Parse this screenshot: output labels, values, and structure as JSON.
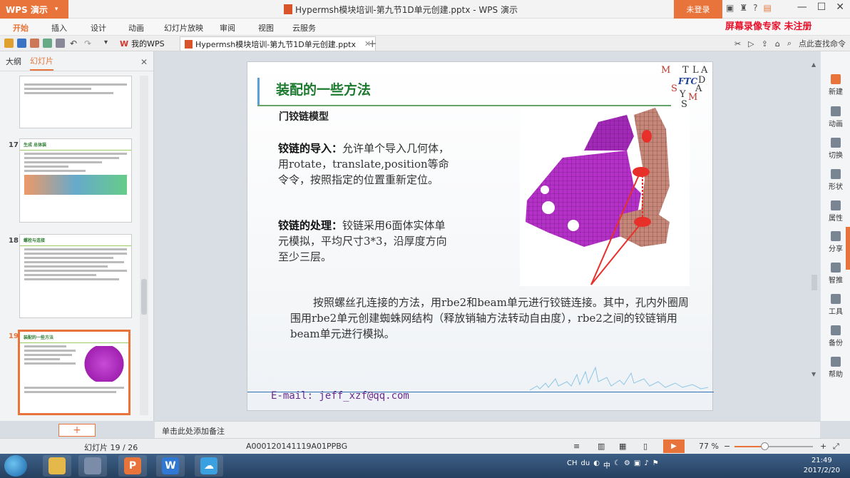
{
  "app": {
    "wps_button": "WPS 演示",
    "document_title": "Hypermsh模块培训-第九节1D单元创建.pptx - WPS 演示",
    "login_button": "未登录",
    "recorder_watermark": "屏幕录像专家 未注册"
  },
  "menu": [
    "开始",
    "插入",
    "设计",
    "动画",
    "幻灯片放映",
    "审阅",
    "视图",
    "云服务"
  ],
  "tabs": {
    "home_tab": "我的WPS",
    "doc_tab": "Hypermsh模块培训-第九节1D单元创建.pptx",
    "search_placeholder": "点此查找命令"
  },
  "left_panel": {
    "tab_outline": "大纲",
    "tab_slides": "幻灯片",
    "thumbnails": [
      {
        "num": "17",
        "title": "生成 总体装"
      },
      {
        "num": "18",
        "title": "螺栓与连接"
      },
      {
        "num": "19",
        "title": "装配的一些方法"
      }
    ]
  },
  "slide": {
    "title": "装配的一些方法",
    "subtitle": "门铰链模型",
    "para1_bold": "铰链的导入：",
    "para1_text": "允许单个导入几何体，用rotate，translate,position等命令令，按照指定的位置重新定位。",
    "para2_bold": "铰链的处理：",
    "para2_text": "铰链采用6面体实体单元模拟，平均尺寸3*3，沿厚度方向至少三层。",
    "bottom_text": "按照螺丝孔连接的方法，用rbe2和beam单元进行铰链连接。其中，孔内外圈周围用rbe2单元创建蜘蛛网结构（释放销轴方法转动自由度），rbe2之间的铰链销用beam单元进行模拟。",
    "email": "E-mail: jeff_xzf@qq.com",
    "logo_letters": [
      "M",
      "T",
      "L",
      "A",
      "B",
      "FTC",
      "D",
      "S",
      "Y",
      "A",
      "M",
      "S"
    ]
  },
  "right_sidebar": [
    "新建",
    "动画",
    "切换",
    "形状",
    "属性",
    "分享",
    "智推",
    "工具",
    "备份",
    "帮助"
  ],
  "notes_placeholder": "单击此处添加备注",
  "status": {
    "slide_counter": "幻灯片 19 / 26",
    "file_code": "A000120141119A01PPBG",
    "zoom": "77 %"
  },
  "taskbar": {
    "time": "21:49",
    "date": "2017/2/20",
    "tray_lang": "CH"
  },
  "colors": {
    "accent": "#e8743b",
    "slide_title": "#1b7a2e",
    "email": "#6a2a8e",
    "model_magenta": "#b530c8"
  }
}
